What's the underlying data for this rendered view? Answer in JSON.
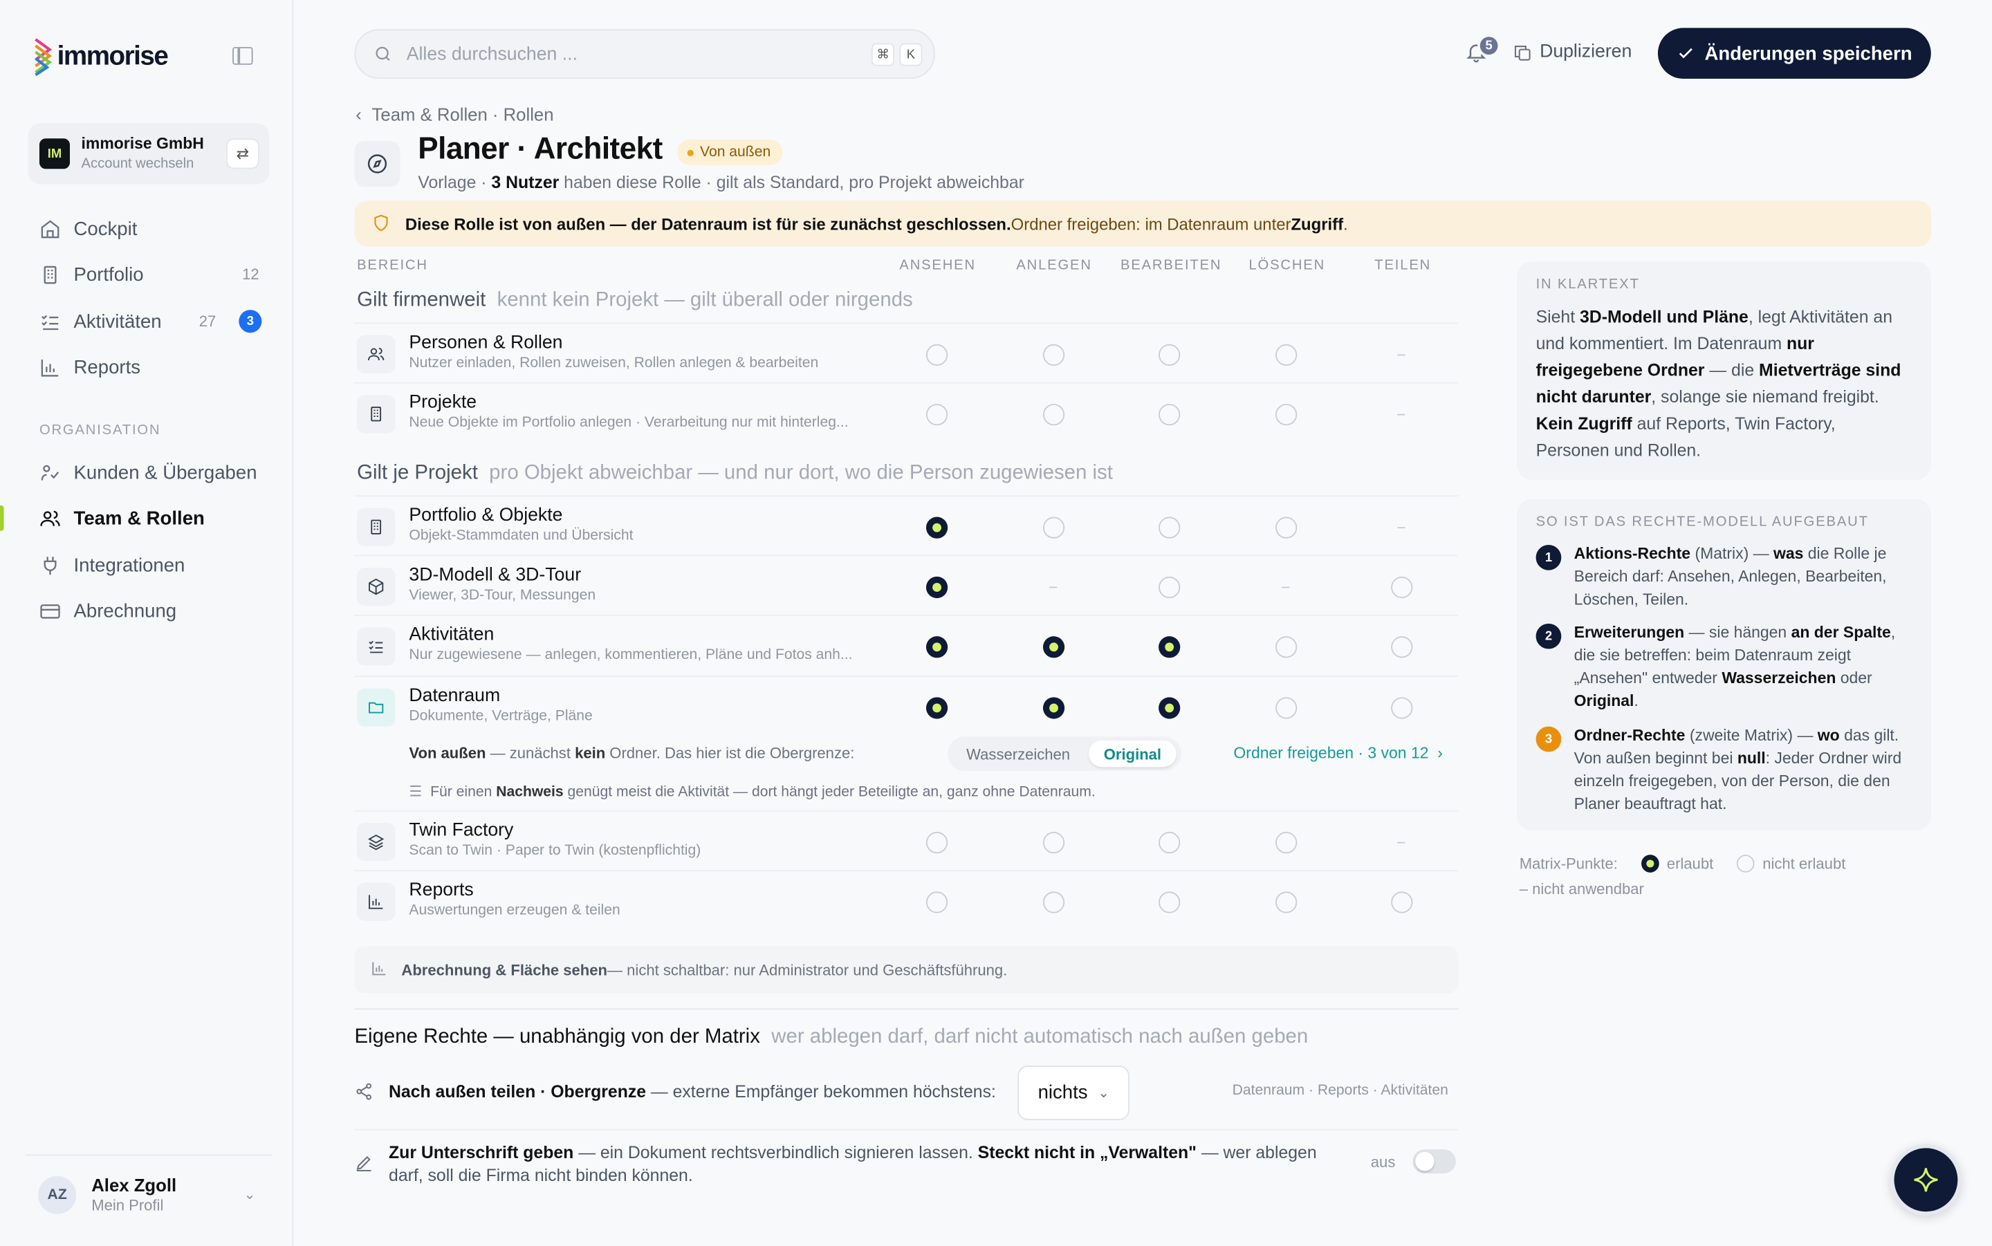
{
  "sidebar": {
    "logo_text": "immorise",
    "account": {
      "initials": "IM",
      "name": "immorise GmbH",
      "sub": "Account wechseln"
    },
    "nav": [
      {
        "label": "Cockpit",
        "count": ""
      },
      {
        "label": "Portfolio",
        "count": "12"
      },
      {
        "label": "Aktivitäten",
        "count": "27",
        "badge": "3"
      },
      {
        "label": "Reports",
        "count": ""
      }
    ],
    "section_label": "ORGANISATION",
    "org_nav": [
      {
        "label": "Kunden & Übergaben"
      },
      {
        "label": "Team & Rollen"
      },
      {
        "label": "Integrationen"
      },
      {
        "label": "Abrechnung"
      }
    ],
    "profile": {
      "initials": "AZ",
      "name": "Alex Zgoll",
      "sub": "Mein Profil"
    }
  },
  "topbar": {
    "search_placeholder": "Alles durchsuchen ...",
    "kbd1": "⌘",
    "kbd2": "K",
    "notifications": "5",
    "duplicate": "Duplizieren",
    "save": "Änderungen speichern"
  },
  "header": {
    "breadcrumb": "Team & Rollen · Rollen",
    "title": "Planer · Architekt",
    "badge": "Von außen",
    "sub_pre": "Vorlage · ",
    "sub_users": "3 Nutzer",
    "sub_post": " haben diese Rolle · gilt als Standard, pro Projekt abweichbar"
  },
  "alert": {
    "bold": "Diese Rolle ist von außen — der Datenraum ist für sie zunächst geschlossen.",
    "text": " Ordner freigeben: im Datenraum unter ",
    "link": "Zugriff",
    "end": "."
  },
  "matrix": {
    "columns": [
      "BEREICH",
      "ANSEHEN",
      "ANLEGEN",
      "BEARBEITEN",
      "LÖSCHEN",
      "TEILEN"
    ],
    "group1": {
      "title": "Gilt firmenweit",
      "hint": "kennt kein Projekt — gilt überall oder nirgends"
    },
    "group2": {
      "title": "Gilt je Projekt",
      "hint": "pro Objekt abweichbar — und nur dort, wo die Person zugewiesen ist"
    },
    "rows": [
      {
        "title": "Personen & Rollen",
        "sub": "Nutzer einladen, Rollen zuweisen, Rollen anlegen & bearbeiten",
        "cells": [
          "off",
          "off",
          "off",
          "off",
          "na"
        ]
      },
      {
        "title": "Projekte",
        "sub": "Neue Objekte im Portfolio anlegen · Verarbeitung nur mit hinterleg...",
        "cells": [
          "off",
          "off",
          "off",
          "off",
          "na"
        ]
      },
      {
        "title": "Portfolio & Objekte",
        "sub": "Objekt-Stammdaten und Übersicht",
        "cells": [
          "on",
          "off",
          "off",
          "off",
          "na"
        ]
      },
      {
        "title": "3D-Modell & 3D-Tour",
        "sub": "Viewer, 3D-Tour, Messungen",
        "cells": [
          "on",
          "na",
          "off",
          "na",
          "off"
        ]
      },
      {
        "title": "Aktivitäten",
        "sub": "Nur zugewiesene — anlegen, kommentieren, Pläne und Fotos anh...",
        "cells": [
          "on",
          "on",
          "on",
          "off",
          "off"
        ]
      },
      {
        "title": "Datenraum",
        "sub": "Dokumente, Verträge, Pläne",
        "cells": [
          "on",
          "on",
          "on",
          "off",
          "off"
        ]
      },
      {
        "title": "Twin Factory",
        "sub": "Scan to Twin · Paper to Twin (kostenpflichtig)",
        "cells": [
          "off",
          "off",
          "off",
          "off",
          "na"
        ]
      },
      {
        "title": "Reports",
        "sub": "Auswertungen erzeugen & teilen",
        "cells": [
          "off",
          "off",
          "off",
          "off",
          "off"
        ]
      }
    ],
    "datenraum_ext": {
      "pre": "Von außen",
      "mid": " — zunächst ",
      "kein": "kein",
      "post": " Ordner. Das hier ist die Obergrenze:",
      "seg_watermark": "Wasserzeichen",
      "seg_original": "Original",
      "share": "Ordner freigeben · 3 von 12",
      "note_pre": "Für einen ",
      "note_bold": "Nachweis",
      "note_post": " genügt meist die Aktivität — dort hängt jeder Beteiligte an, ganz ohne Datenraum."
    },
    "billing_bold": "Abrechnung & Fläche sehen",
    "billing_text": " — nicht schaltbar: nur Administrator und Geschäftsführung."
  },
  "own_rights": {
    "title": "Eigene Rechte — unabhängig von der Matrix",
    "hint": "wer ablegen darf, darf nicht automatisch nach außen geben",
    "share_bold": "Nach außen teilen · Obergrenze",
    "share_text": " — externe Empfänger bekommen höchstens:",
    "dropdown": "nichts",
    "scope": "Datenraum · Reports · Aktivitäten",
    "sign_bold": "Zur Unterschrift geben",
    "sign_text1": " — ein Dokument rechtsverbindlich signieren lassen. ",
    "sign_bold2": "Steckt nicht in „Verwalten\"",
    "sign_text2": " — wer ablegen",
    "sign_text3": "darf, soll die Firma nicht binden können.",
    "toggle_label": "aus"
  },
  "klartext": {
    "title": "IN KLARTEXT",
    "p1": "Sieht ",
    "b1": "3D-Modell und Pläne",
    "p2": ", legt Aktivitäten an und kommentiert. Im Datenraum ",
    "b2": "nur freigegebene Ordner",
    "p3": " — die ",
    "b3": "Mietverträge sind nicht darunter",
    "p4": ", solange sie niemand freigibt. ",
    "b4": "Kein Zugriff",
    "p5": " auf Reports, Twin Factory, Personen und Rollen."
  },
  "model": {
    "title": "SO IST DAS RECHTE-MODELL AUFGEBAUT",
    "steps": [
      {
        "n": "1",
        "bold": "Aktions-Rechte",
        "t1": " (Matrix) — ",
        "b2": "was",
        "t2": " die Rolle je Bereich darf: Ansehen, Anlegen, Bearbeiten, Löschen, Teilen."
      },
      {
        "n": "2",
        "bold": "Erweiterungen",
        "t1": " — sie hängen ",
        "b2": "an der Spalte",
        "t2": ", die sie betreffen: beim Datenraum zeigt „Ansehen\" entweder ",
        "b3": "Wasserzeichen",
        "t3": " oder ",
        "b4": "Original",
        "t4": "."
      },
      {
        "n": "3",
        "bold": "Ordner-Rechte",
        "t1": " (zweite Matrix) — ",
        "b2": "wo",
        "t2": " das gilt. Von außen beginnt bei ",
        "b3": "null",
        "t3": ": Jeder Ordner wird einzeln freigegeben, von der Person, die den Planer beauftragt hat."
      }
    ]
  },
  "legend": {
    "title": "Matrix-Punkte:",
    "allowed": "erlaubt",
    "not_allowed": "nicht erlaubt",
    "na": "– nicht anwendbar"
  },
  "colors": {
    "primary": "#0f1a36",
    "accent": "#d4f26a",
    "teal": "#149a9a",
    "warning_bg": "#fbf0dc"
  }
}
